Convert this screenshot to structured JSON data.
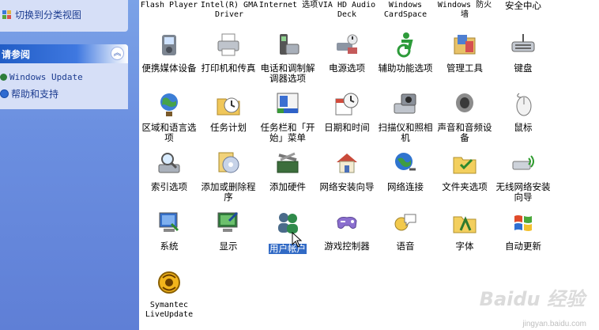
{
  "sidebar": {
    "switch_view": "切换到分类视图",
    "see_also_title": "请参阅",
    "links": [
      "Windows Update",
      "帮助和支持"
    ]
  },
  "top_row": [
    "Flash Player",
    "Intel(R) GMA Driver",
    "Internet 选项",
    "VIA HD Audio Deck",
    "Windows CardSpace",
    "Windows 防火墙",
    "安全中心"
  ],
  "items": [
    {
      "label": "便携媒体设备",
      "icon": "portable-media-icon"
    },
    {
      "label": "打印机和传真",
      "icon": "printer-icon"
    },
    {
      "label": "电话和调制解调器选项",
      "icon": "phone-modem-icon"
    },
    {
      "label": "电源选项",
      "icon": "power-icon"
    },
    {
      "label": "辅助功能选项",
      "icon": "accessibility-icon"
    },
    {
      "label": "管理工具",
      "icon": "admin-tools-icon"
    },
    {
      "label": "键盘",
      "icon": "keyboard-icon"
    },
    {
      "label": "区域和语言选项",
      "icon": "globe-icon"
    },
    {
      "label": "任务计划",
      "icon": "scheduled-tasks-icon"
    },
    {
      "label": "任务栏和「开始」菜单",
      "icon": "taskbar-icon"
    },
    {
      "label": "日期和时间",
      "icon": "clock-icon"
    },
    {
      "label": "扫描仪和照相机",
      "icon": "scanner-camera-icon"
    },
    {
      "label": "声音和音频设备",
      "icon": "speaker-icon"
    },
    {
      "label": "鼠标",
      "icon": "mouse-icon"
    },
    {
      "label": "索引选项",
      "icon": "search-index-icon"
    },
    {
      "label": "添加或删除程序",
      "icon": "add-remove-icon"
    },
    {
      "label": "添加硬件",
      "icon": "hardware-icon"
    },
    {
      "label": "网络安装向导",
      "icon": "network-house-icon"
    },
    {
      "label": "网络连接",
      "icon": "network-globe-icon"
    },
    {
      "label": "文件夹选项",
      "icon": "folder-icon"
    },
    {
      "label": "无线网络安装向导",
      "icon": "wireless-icon"
    },
    {
      "label": "系统",
      "icon": "system-icon"
    },
    {
      "label": "显示",
      "icon": "display-icon"
    },
    {
      "label": "用户帐户",
      "icon": "users-icon"
    },
    {
      "label": "游戏控制器",
      "icon": "gamepad-icon"
    },
    {
      "label": "语音",
      "icon": "speech-icon"
    },
    {
      "label": "字体",
      "icon": "fonts-icon"
    },
    {
      "label": "自动更新",
      "icon": "windows-flag-icon"
    },
    {
      "label": "Symantec LiveUpdate",
      "icon": "liveupdate-icon"
    }
  ],
  "selected_item": "用户帐户",
  "watermark": {
    "brand": "Baidu 经验",
    "url": "jingyan.baidu.com"
  }
}
